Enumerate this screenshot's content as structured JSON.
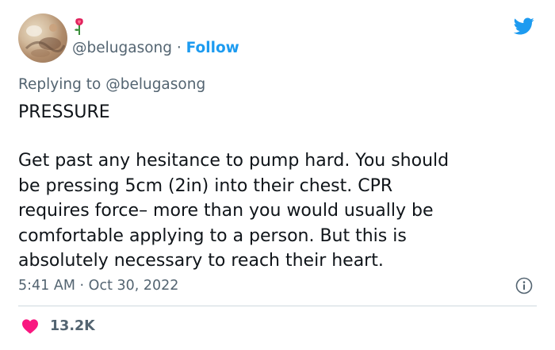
{
  "tweet": {
    "handle": "@belugasong",
    "separator": "·",
    "follow_label": "Follow",
    "replying_prefix": "Replying to",
    "replying_to": "@belugasong",
    "headline": "PRESSURE",
    "body_lines": [
      "Get past any hesitance to pump hard. You should",
      "be pressing 5cm (2in) into their chest. CPR",
      "requires force– more than you would usually be",
      "comfortable applying to a person. But this is",
      "absolutely necessary to reach their heart."
    ],
    "time": "5:41 AM",
    "date": "Oct 30, 2022",
    "like_count": "13.2K"
  },
  "icons": {
    "brand": "twitter-bird-icon",
    "badge": "rose-emoji-icon",
    "info": "info-icon",
    "like": "heart-icon"
  },
  "colors": {
    "accent": "#1d9bf0",
    "muted_text": "#536471",
    "like": "#f91880",
    "text": "#0f1419"
  }
}
